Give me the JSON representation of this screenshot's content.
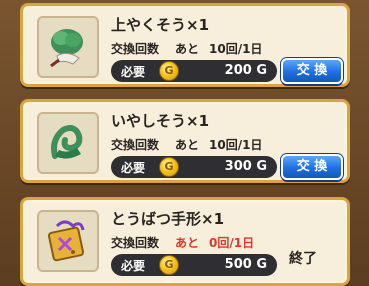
{
  "items": [
    {
      "name": "上やくそう×1",
      "exchange_label": "交換回数",
      "remaining_word": "あと",
      "count": "10回/1日",
      "required_label": "必要",
      "coin_glyph": "G",
      "price": "200 G",
      "action": "交 換",
      "icon": "herb-icon"
    },
    {
      "name": "いやしそう×1",
      "exchange_label": "交換回数",
      "remaining_word": "あと",
      "count": "10回/1日",
      "required_label": "必要",
      "coin_glyph": "G",
      "price": "300 G",
      "action": "交 換",
      "icon": "healing-herb-icon"
    },
    {
      "name": "とうばつ手形×1",
      "exchange_label": "交換回数",
      "remaining_word": "あと",
      "count": "0回/1日",
      "required_label": "必要",
      "coin_glyph": "G",
      "price": "500 G",
      "status": "終了",
      "icon": "subjugation-ticket-icon"
    }
  ],
  "colors": {
    "card_border": "#d9a441",
    "button_blue": "#1f6fe0",
    "sold_out_red": "#d83a2a"
  }
}
